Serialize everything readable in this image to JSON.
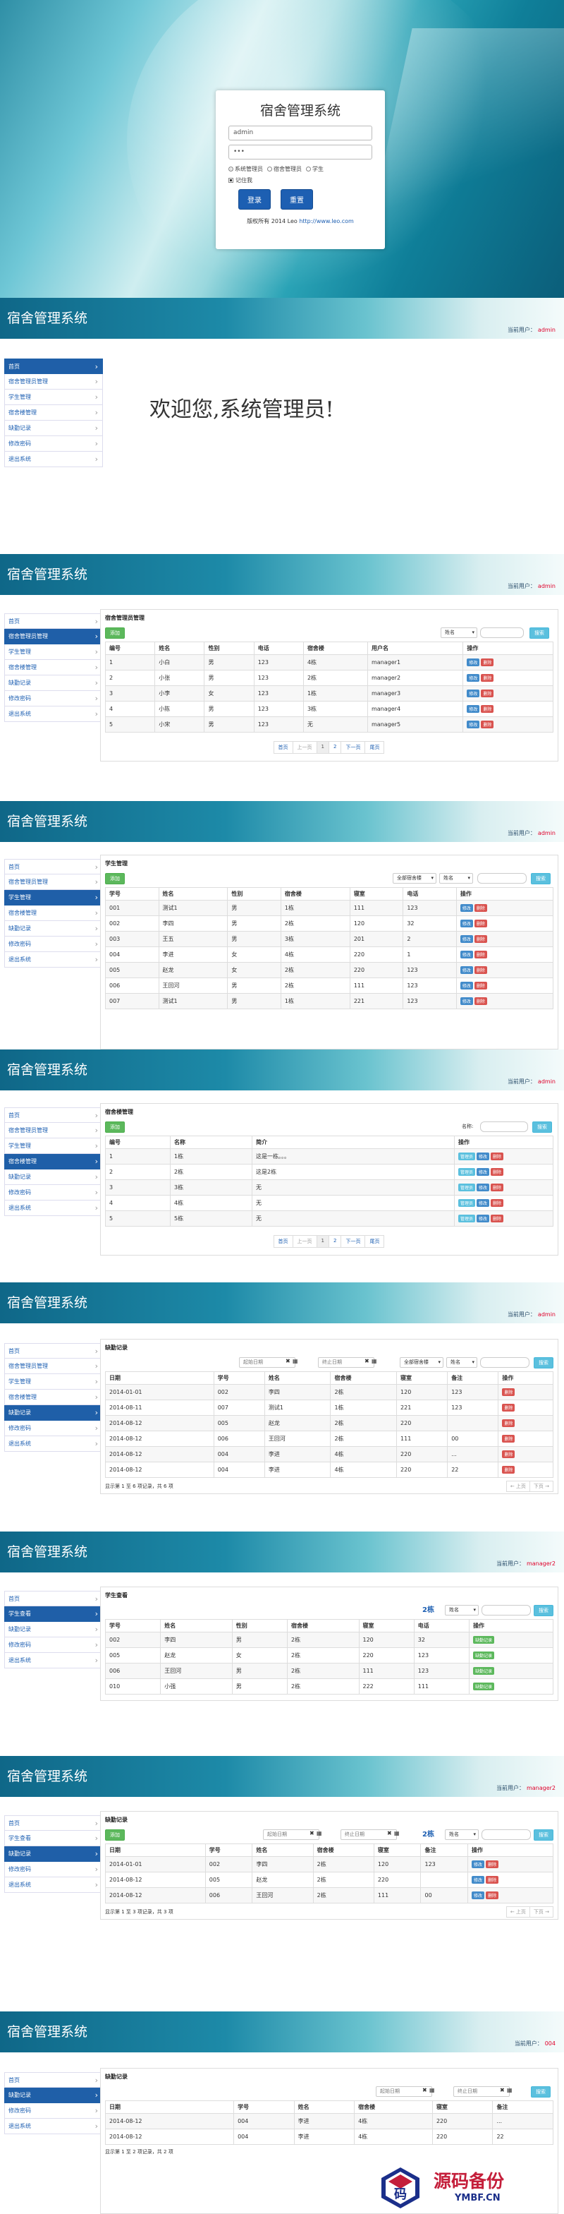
{
  "login": {
    "title": "宿舍管理系统",
    "username": "admin",
    "password": "•••",
    "roles": [
      "系统管理员",
      "宿舍管理员",
      "学生"
    ],
    "remember": "记住我",
    "login_btn": "登录",
    "reset_btn": "重置",
    "copyright": "版权所有 2014 Leo",
    "copyright_link": "http://www.leo.com"
  },
  "app_title": "宿舍管理系统",
  "user_prefix": "当前用户：",
  "admin_menu": [
    "首页",
    "宿舍管理员管理",
    "学生管理",
    "宿舍楼管理",
    "缺勤记录",
    "修改密码",
    "退出系统"
  ],
  "s1": {
    "user": "admin",
    "welcome": "欢迎您,系统管理员!"
  },
  "s2": {
    "user": "admin",
    "title": "宿舍管理员管理",
    "add": "添加",
    "select": "姓名",
    "search": "搜索",
    "headers": [
      "编号",
      "姓名",
      "性别",
      "电话",
      "宿舍楼",
      "用户名",
      "操作"
    ],
    "rows": [
      [
        "1",
        "小白",
        "男",
        "123",
        "4栋",
        "manager1"
      ],
      [
        "2",
        "小张",
        "男",
        "123",
        "2栋",
        "manager2"
      ],
      [
        "3",
        "小李",
        "女",
        "123",
        "1栋",
        "manager3"
      ],
      [
        "4",
        "小陈",
        "男",
        "123",
        "3栋",
        "manager4"
      ],
      [
        "5",
        "小宋",
        "男",
        "123",
        "无",
        "manager5"
      ]
    ],
    "edit": "修改",
    "del": "删除",
    "pager": [
      "首页",
      "上一页",
      "1",
      "2",
      "下一页",
      "尾页"
    ]
  },
  "s3": {
    "user": "admin",
    "title": "学生管理",
    "add": "添加",
    "select1": "全部宿舍楼",
    "select2": "姓名",
    "search": "搜索",
    "headers": [
      "学号",
      "姓名",
      "性别",
      "宿舍楼",
      "寝室",
      "电话",
      "操作"
    ],
    "rows": [
      [
        "001",
        "测试1",
        "男",
        "1栋",
        "111",
        "123"
      ],
      [
        "002",
        "李四",
        "男",
        "2栋",
        "120",
        "32"
      ],
      [
        "003",
        "王五",
        "男",
        "3栋",
        "201",
        "2"
      ],
      [
        "004",
        "李进",
        "女",
        "4栋",
        "220",
        "1"
      ],
      [
        "005",
        "赵龙",
        "女",
        "2栋",
        "220",
        "123"
      ],
      [
        "006",
        "王回河",
        "男",
        "2栋",
        "111",
        "123"
      ],
      [
        "007",
        "测试1",
        "男",
        "1栋",
        "221",
        "123"
      ]
    ],
    "edit": "修改",
    "del": "删除"
  },
  "s4": {
    "user": "admin",
    "title": "宿舍楼管理",
    "add": "添加",
    "label": "名称:",
    "search": "搜索",
    "headers": [
      "编号",
      "名称",
      "简介",
      "操作"
    ],
    "rows": [
      [
        "1",
        "1栋",
        "这是一栋。。。"
      ],
      [
        "2",
        "2栋",
        "这是2栋"
      ],
      [
        "3",
        "3栋",
        "无"
      ],
      [
        "4",
        "4栋",
        "无"
      ],
      [
        "5",
        "5栋",
        "无"
      ]
    ],
    "mgr": "管理员",
    "edit": "修改",
    "del": "删除",
    "pager": [
      "首页",
      "上一页",
      "1",
      "2",
      "下一页",
      "尾页"
    ]
  },
  "s5": {
    "user": "admin",
    "title": "缺勤记录",
    "start": "起始日期",
    "end": "终止日期",
    "select1": "全部宿舍楼",
    "select2": "姓名",
    "search": "搜索",
    "headers": [
      "日期",
      "学号",
      "姓名",
      "宿舍楼",
      "寝室",
      "备注",
      "操作"
    ],
    "rows": [
      [
        "2014-01-01",
        "002",
        "李四",
        "2栋",
        "120",
        "123"
      ],
      [
        "2014-08-11",
        "007",
        "测试1",
        "1栋",
        "221",
        "123"
      ],
      [
        "2014-08-12",
        "005",
        "赵龙",
        "2栋",
        "220",
        ""
      ],
      [
        "2014-08-12",
        "006",
        "王回河",
        "2栋",
        "111",
        "00"
      ],
      [
        "2014-08-12",
        "004",
        "李进",
        "4栋",
        "220",
        "..."
      ],
      [
        "2014-08-12",
        "004",
        "李进",
        "4栋",
        "220",
        "22"
      ]
    ],
    "del": "删除",
    "info": "显示第 1 至 6 项记录，共 6 项",
    "pager": [
      "← 上页",
      "下页 →"
    ]
  },
  "dorm_menu": [
    "首页",
    "学生查看",
    "缺勤记录",
    "修改密码",
    "退出系统"
  ],
  "s6": {
    "user": "manager2",
    "title": "学生查看",
    "dorm": "2栋",
    "select": "姓名",
    "search": "搜索",
    "headers": [
      "学号",
      "姓名",
      "性别",
      "宿舍楼",
      "寝室",
      "电话",
      "操作"
    ],
    "rows": [
      [
        "002",
        "李四",
        "男",
        "2栋",
        "120",
        "32"
      ],
      [
        "005",
        "赵龙",
        "女",
        "2栋",
        "220",
        "123"
      ],
      [
        "006",
        "王回河",
        "男",
        "2栋",
        "111",
        "123"
      ],
      [
        "010",
        "小强",
        "男",
        "2栋",
        "222",
        "111"
      ]
    ],
    "action": "缺勤记录"
  },
  "s7": {
    "user": "manager2",
    "title": "缺勤记录",
    "add": "添加",
    "start": "起始日期",
    "end": "终止日期",
    "dorm": "2栋",
    "select": "姓名",
    "search": "搜索",
    "headers": [
      "日期",
      "学号",
      "姓名",
      "宿舍楼",
      "寝室",
      "备注",
      "操作"
    ],
    "rows": [
      [
        "2014-01-01",
        "002",
        "李四",
        "2栋",
        "120",
        "123"
      ],
      [
        "2014-08-12",
        "005",
        "赵龙",
        "2栋",
        "220",
        ""
      ],
      [
        "2014-08-12",
        "006",
        "王回河",
        "2栋",
        "111",
        "00"
      ]
    ],
    "edit": "修改",
    "del": "删除",
    "info": "显示第 1 至 3 项记录，共 3 项",
    "pager": [
      "← 上页",
      "下页 →"
    ]
  },
  "stu_menu": [
    "首页",
    "缺勤记录",
    "修改密码",
    "退出系统"
  ],
  "s8": {
    "user": "004",
    "title": "缺勤记录",
    "start": "起始日期",
    "end": "终止日期",
    "search": "搜索",
    "headers": [
      "日期",
      "学号",
      "姓名",
      "宿舍楼",
      "寝室",
      "备注"
    ],
    "rows": [
      [
        "2014-08-12",
        "004",
        "李进",
        "4栋",
        "220",
        "..."
      ],
      [
        "2014-08-12",
        "004",
        "李进",
        "4栋",
        "220",
        "22"
      ]
    ],
    "info": "显示第 1 至 2 项记录，共 2 项"
  },
  "watermark": {
    "title": "源码备份",
    "url": "YMBF.CN",
    "logo_char": "码"
  }
}
